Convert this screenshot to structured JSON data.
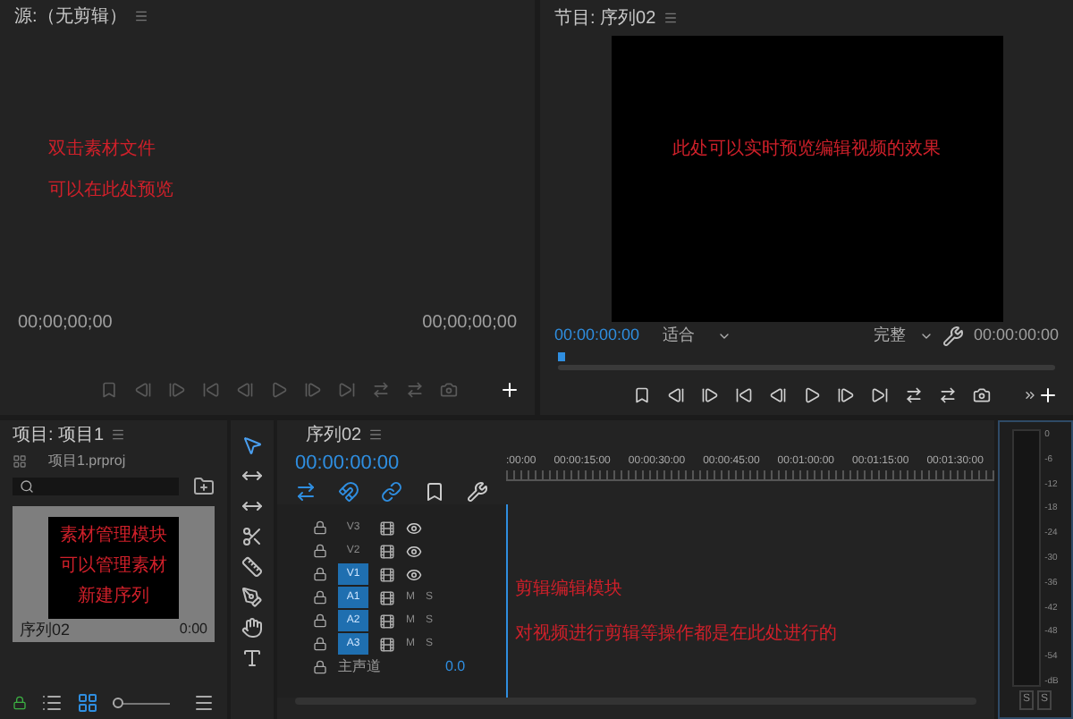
{
  "source_panel": {
    "title": "源:（无剪辑）",
    "notes": [
      "双击素材文件",
      "可以在此处预览"
    ],
    "timecode_in": "00;00;00;00",
    "timecode_out": "00;00;00;00"
  },
  "program_panel": {
    "title": "节目: 序列02",
    "note": "此处可以实时预览编辑视频的效果",
    "timecode": "00:00:00:00",
    "zoom": "适合",
    "quality": "完整",
    "duration": "00:00:00:00"
  },
  "project_panel": {
    "title": "项目: 项目1",
    "file": "项目1.prproj",
    "zoom_slider": {
      "level": 0
    },
    "item": {
      "notes": [
        "素材管理模块",
        "可以管理素材",
        "新建序列"
      ],
      "name": "序列02",
      "duration": "0:00"
    }
  },
  "timeline": {
    "title": "序列02",
    "timecode": "00:00:00:00",
    "ruler": [
      ":00:00",
      "00:00:15:00",
      "00:00:30:00",
      "00:00:45:00",
      "00:01:00:00",
      "00:01:15:00",
      "00:01:30:00"
    ],
    "tracks": [
      {
        "kind": "video",
        "name": "V3",
        "selected": false
      },
      {
        "kind": "video",
        "name": "V2",
        "selected": false
      },
      {
        "kind": "video",
        "name": "V1",
        "selected": true
      },
      {
        "kind": "audio",
        "name": "A1",
        "selected": true,
        "m": "M",
        "s": "S"
      },
      {
        "kind": "audio",
        "name": "A2",
        "selected": true,
        "m": "M",
        "s": "S"
      },
      {
        "kind": "audio",
        "name": "A3",
        "selected": true,
        "m": "M",
        "s": "S"
      },
      {
        "kind": "master",
        "name": "主声道",
        "value": "0.0"
      }
    ],
    "notes": [
      "剪辑编辑模块",
      "对视频进行剪辑等操作都是在此处进行的"
    ]
  },
  "meter": {
    "scale": [
      "0",
      "-6",
      "-12",
      "-18",
      "-24",
      "-30",
      "-36",
      "-42",
      "-48",
      "-54",
      "-dB"
    ],
    "solo": [
      "S",
      "S"
    ]
  }
}
